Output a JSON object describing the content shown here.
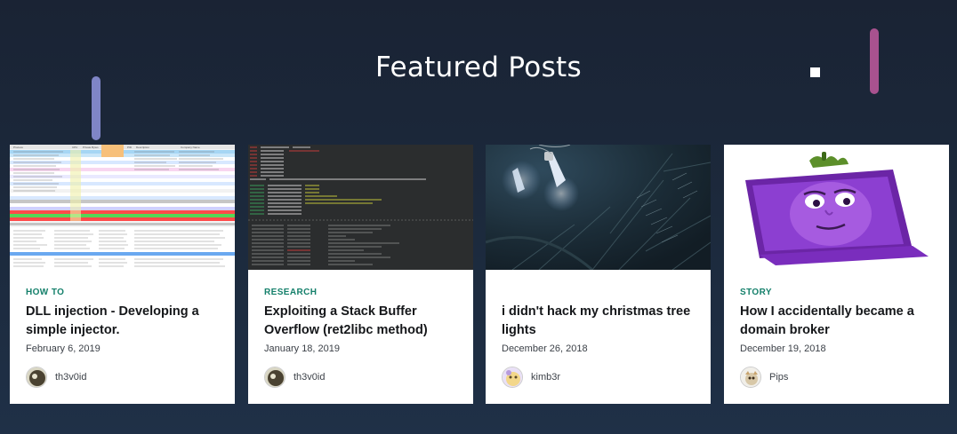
{
  "section": {
    "title": "Featured Posts"
  },
  "posts": [
    {
      "category": "HOW TO",
      "title": "DLL injection - Developing a simple injector.",
      "date": "February 6, 2019",
      "author": "th3v0id",
      "image": "process-explorer-screenshot"
    },
    {
      "category": "RESEARCH",
      "title": "Exploiting a Stack Buffer Overflow (ret2libc method)",
      "date": "January 18, 2019",
      "author": "th3v0id",
      "image": "debugger-terminal-screenshot"
    },
    {
      "category": "",
      "title": "i didn't hack my christmas tree lights",
      "date": "December 26, 2018",
      "author": "kimb3r",
      "image": "christmas-tree-lights-photo"
    },
    {
      "category": "STORY",
      "title": "How I accidentally became a domain broker",
      "date": "December 19, 2018",
      "author": "Pips",
      "image": "eggplant-laptop-illustration"
    }
  ],
  "colors": {
    "background": "#1c2a3d",
    "category": "#15806b",
    "accent_bar_left": "#7f85c6",
    "accent_bar_right": "#a8528f"
  }
}
